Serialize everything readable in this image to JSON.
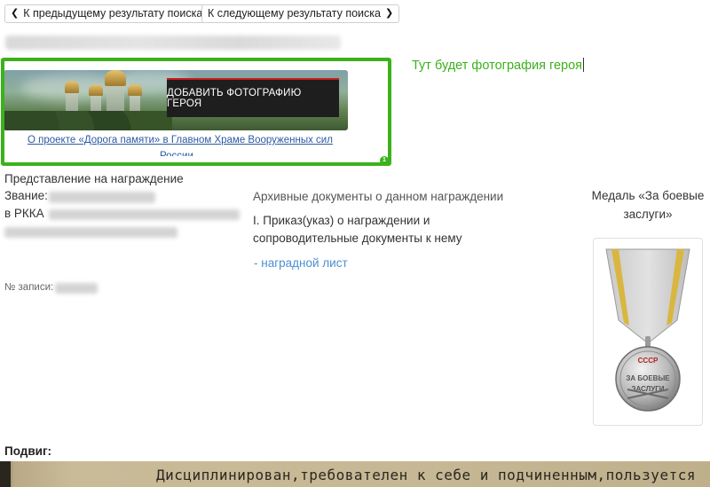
{
  "nav": {
    "prev_label": "К предыдущему результату поиска",
    "next_label": "К следующему результату поиска"
  },
  "banner": {
    "button_label": "ДОБАВИТЬ ФОТОГРАФИЮ ГЕРОЯ",
    "link_text": "О проекте «Дорога памяти» в Главном Храме Вооруженных сил",
    "link_text_cont": "России"
  },
  "annotation": {
    "note": "Тут будет фотография героя",
    "frame_color": "#3bb21b"
  },
  "record": {
    "section_title": "Представление на награждение",
    "rank_label": "Звание:",
    "rkka_label": "в РККА",
    "record_no_label": "№ записи:"
  },
  "archive": {
    "heading": "Архивные документы о данном награждении",
    "subheading": "I. Приказ(указ) о награждении и сопроводительные документы к нему",
    "link": "- наградной лист"
  },
  "medal": {
    "title": "Медаль «За боевые заслуги»",
    "inscription_top": "СССР",
    "inscription_mid": "ЗА БОЕВЫЕ",
    "inscription_bottom": "ЗАСЛУГИ"
  },
  "feat": {
    "label": "Подвиг:",
    "text": "Дисциплинирован,требователен к себе и подчиненным,пользуется"
  },
  "colors": {
    "link": "#2c5aa0",
    "doc_link": "#4b8fd1",
    "accent_red": "#c81e1e"
  }
}
